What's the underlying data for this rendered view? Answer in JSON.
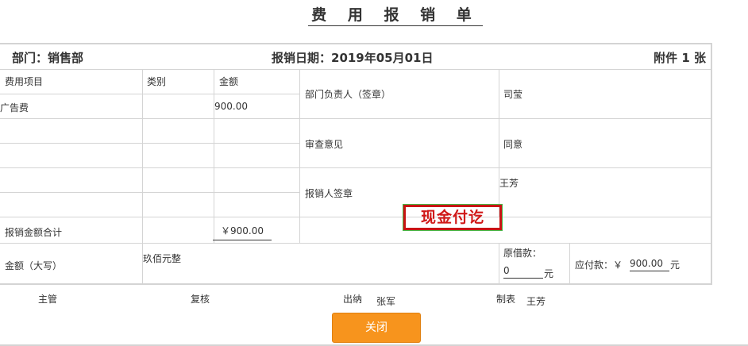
{
  "title": "费 用 报 销 单",
  "header": {
    "department": "部门：销售部",
    "date": "报销日期：2019年05月01日",
    "attachments": "附件 1 张"
  },
  "columns": {
    "item": "费用项目",
    "category": "类别",
    "amount": "金额"
  },
  "rows": [
    {
      "item": "广告费",
      "category": "",
      "amount": "900.00"
    }
  ],
  "approvals": {
    "dept_head_label": "部门负责人（签章）",
    "dept_head_value": "司莹",
    "review_label": "审查意见",
    "review_value": "同意",
    "claimant_label": "报销人签章",
    "claimant_value": "王芳"
  },
  "total": {
    "label": "报销金额合计",
    "value": "￥900.00"
  },
  "amount_words": {
    "label": "金额（大写）",
    "value": "玖佰元整",
    "original_loan_label": "原借款：",
    "original_loan_value": "0",
    "yuan": "元",
    "payable_label": "应付款：￥",
    "payable_value": "900.00",
    "payable_unit": "元"
  },
  "stamp": "现金付讫",
  "signatures": {
    "supervisor_label": "主管",
    "recheck_label": "复核",
    "cashier_label": "出纳",
    "cashier_value": "张军",
    "preparer_label": "制表",
    "preparer_value": "王芳"
  },
  "close_button": "关闭"
}
